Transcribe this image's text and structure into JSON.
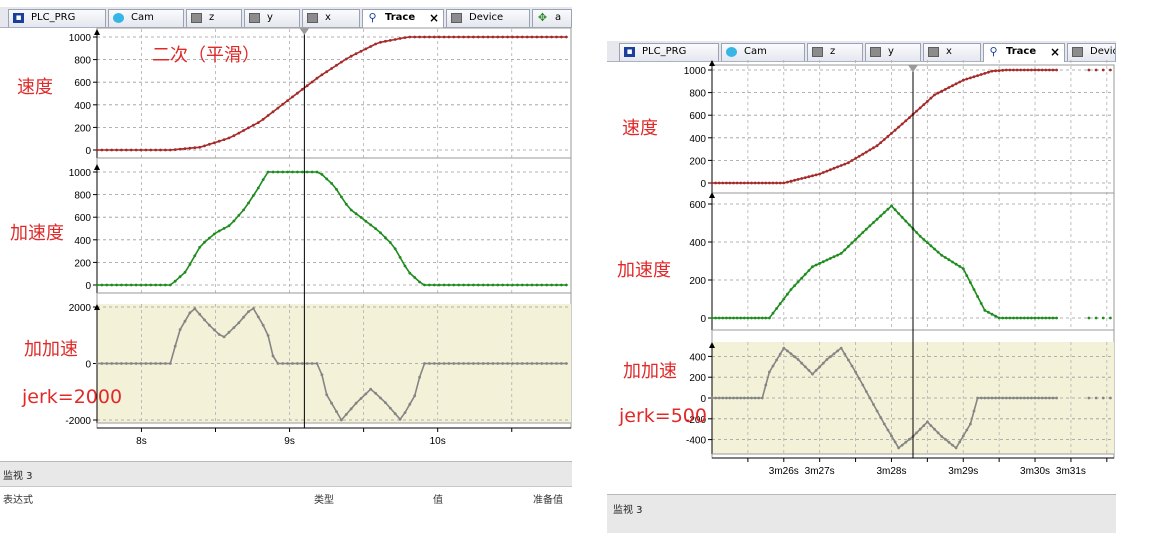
{
  "left": {
    "tabs": [
      {
        "label": "PLC_PRG",
        "icon": "prg-icon",
        "active": false
      },
      {
        "label": "Cam",
        "icon": "cam-icon",
        "active": false
      },
      {
        "label": "z",
        "icon": "pou-icon",
        "active": false
      },
      {
        "label": "y",
        "icon": "pou-icon",
        "active": false
      },
      {
        "label": "x",
        "icon": "pou-icon",
        "active": false
      },
      {
        "label": "Trace",
        "icon": "trace-icon",
        "active": true,
        "close": "×"
      },
      {
        "label": "Device",
        "icon": "pou-icon",
        "active": false
      },
      {
        "label": "a",
        "icon": "device-icon",
        "active": false
      }
    ],
    "title_annotation": "二次（平滑）",
    "annotations": {
      "velocity": "速度",
      "acceleration": "加速度",
      "jerk": "加加速",
      "jerk_value": "jerk=2000"
    },
    "axes": {
      "velocity_ticks": [
        "1000",
        "800",
        "600",
        "400",
        "200",
        "0"
      ],
      "accel_ticks": [
        "1000",
        "800",
        "600",
        "400",
        "200",
        "0"
      ],
      "jerk_ticks": [
        "2000",
        "0",
        "-2000"
      ],
      "time_ticks": [
        "8s",
        "9s",
        "10s"
      ]
    },
    "status": {
      "watch": "监视 3",
      "col_expression": "表达式",
      "col_type": "类型",
      "col_value": "值",
      "col_prepared": "准备值"
    }
  },
  "right": {
    "tabs": [
      {
        "label": "PLC_PRG",
        "icon": "prg-icon",
        "active": false
      },
      {
        "label": "Cam",
        "icon": "cam-icon",
        "active": false
      },
      {
        "label": "z",
        "icon": "pou-icon",
        "active": false
      },
      {
        "label": "y",
        "icon": "pou-icon",
        "active": false
      },
      {
        "label": "x",
        "icon": "pou-icon",
        "active": false
      },
      {
        "label": "Trace",
        "icon": "trace-icon",
        "active": true,
        "close": "×"
      },
      {
        "label": "Device",
        "icon": "pou-icon",
        "active": false
      }
    ],
    "annotations": {
      "velocity": "速度",
      "acceleration": "加速度",
      "jerk": "加加速",
      "jerk_value": "jerk=500"
    },
    "axes": {
      "velocity_ticks": [
        "1000",
        "800",
        "600",
        "400",
        "200",
        "0"
      ],
      "accel_ticks": [
        "600",
        "400",
        "200",
        "0"
      ],
      "jerk_ticks": [
        "400",
        "200",
        "0",
        "-200",
        "-400"
      ],
      "time_ticks": [
        "3m26s",
        "3m27s",
        "3m28s",
        "3m29s",
        "3m30s",
        "3m31s"
      ]
    },
    "status": {
      "watch": "监视 3"
    }
  },
  "colors": {
    "velocity": "#a52a2a",
    "acceleration": "#1e8c1e",
    "jerk": "#858585",
    "jerk_background": "#f3f2d8",
    "annotation": "#e02a2a"
  },
  "chart_data": [
    {
      "type": "line",
      "panel": "left",
      "x_ticks": [
        "8s",
        "9s",
        "10s"
      ],
      "subplots": [
        {
          "name": "速度",
          "ylim": [
            0,
            1000
          ],
          "x": [
            7.7,
            8.2,
            8.4,
            8.6,
            8.8,
            9.0,
            9.2,
            9.4,
            9.6,
            9.8,
            10.0,
            10.2,
            10.9
          ],
          "values": [
            0,
            0,
            25,
            110,
            250,
            450,
            650,
            820,
            950,
            1000,
            1000,
            1000,
            1000
          ]
        },
        {
          "name": "加速度",
          "ylim": [
            0,
            1000
          ],
          "x": [
            7.7,
            8.2,
            8.3,
            8.4,
            8.5,
            8.6,
            8.7,
            8.8,
            8.85,
            9.2,
            9.3,
            9.4,
            9.5,
            9.6,
            9.7,
            9.8,
            9.9,
            10.9
          ],
          "values": [
            0,
            0,
            120,
            350,
            460,
            530,
            680,
            880,
            1000,
            1000,
            880,
            680,
            580,
            480,
            350,
            120,
            0,
            0
          ]
        },
        {
          "name": "加加速",
          "ylim": [
            -2000,
            2000
          ],
          "x": [
            7.7,
            8.2,
            8.25,
            8.35,
            8.45,
            8.55,
            8.65,
            8.75,
            8.85,
            8.9,
            9.2,
            9.25,
            9.35,
            9.45,
            9.55,
            9.65,
            9.75,
            9.85,
            9.9,
            10.9
          ],
          "values": [
            0,
            0,
            1100,
            2000,
            1400,
            900,
            1400,
            2000,
            1100,
            0,
            0,
            -1100,
            -2000,
            -1400,
            -900,
            -1400,
            -2000,
            -1100,
            0,
            0
          ]
        }
      ]
    },
    {
      "type": "line",
      "panel": "right",
      "x_ticks": [
        "3m26s",
        "3m27s",
        "3m28s",
        "3m29s",
        "3m30s",
        "3m31s"
      ],
      "subplots": [
        {
          "name": "速度",
          "ylim": [
            0,
            1000
          ],
          "x": [
            205.5,
            206.5,
            207.0,
            207.4,
            207.8,
            208.2,
            208.6,
            209.0,
            209.4,
            209.6,
            210.0,
            211.1
          ],
          "values": [
            0,
            0,
            80,
            180,
            330,
            550,
            780,
            910,
            990,
            1000,
            1000,
            1000
          ]
        },
        {
          "name": "加速度",
          "ylim": [
            0,
            600
          ],
          "x": [
            205.5,
            206.3,
            206.6,
            206.9,
            207.3,
            207.6,
            208.0,
            208.4,
            208.7,
            209.0,
            209.3,
            209.5,
            211.1
          ],
          "values": [
            0,
            0,
            150,
            270,
            340,
            450,
            590,
            430,
            330,
            260,
            40,
            0,
            0
          ]
        },
        {
          "name": "加加速",
          "ylim": [
            -500,
            500
          ],
          "x": [
            205.5,
            206.2,
            206.3,
            206.5,
            206.7,
            206.9,
            207.1,
            207.3,
            207.5,
            207.7,
            207.9,
            208.1,
            208.3,
            208.5,
            208.7,
            208.9,
            209.1,
            209.2,
            211.1
          ],
          "values": [
            0,
            0,
            250,
            480,
            370,
            230,
            370,
            480,
            250,
            0,
            -250,
            -480,
            -370,
            -230,
            -370,
            -480,
            -250,
            0,
            0
          ]
        }
      ]
    }
  ]
}
